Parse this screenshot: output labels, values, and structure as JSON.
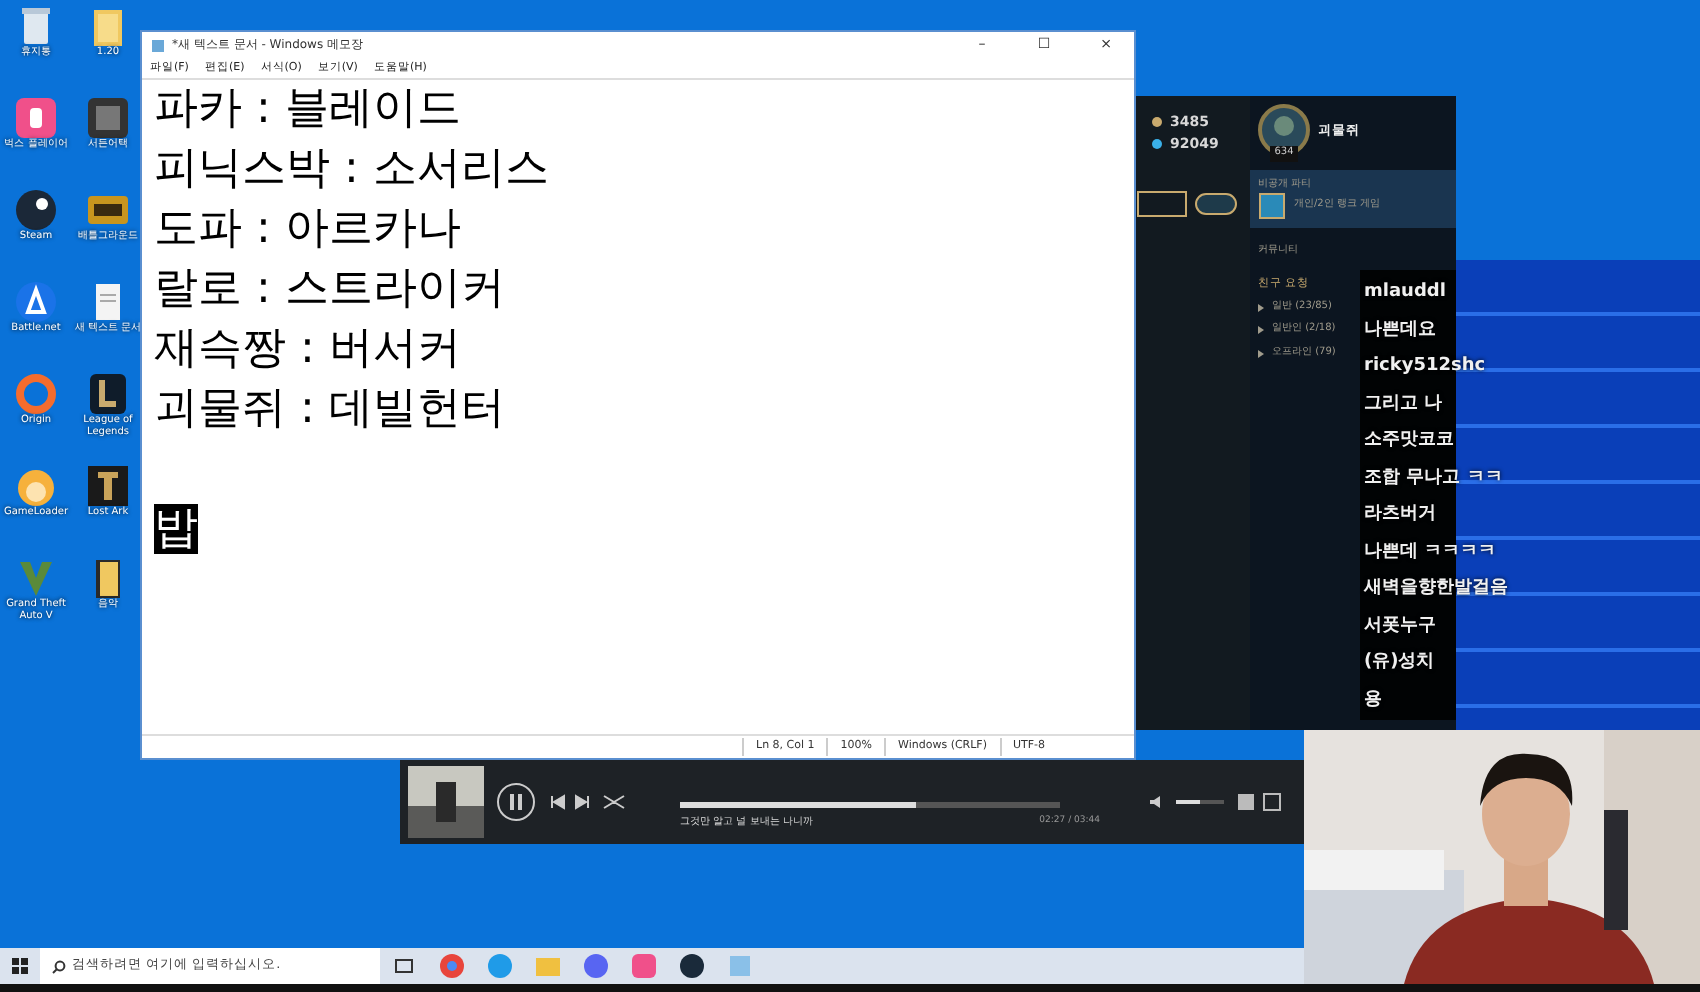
{
  "desktop_icons": [
    {
      "label": "휴지통"
    },
    {
      "label": "1.20"
    },
    {
      "label": "벅스 플레이어"
    },
    {
      "label": "서든어택"
    },
    {
      "label": "Steam"
    },
    {
      "label": "배틀그라운드"
    },
    {
      "label": "Battle.net"
    },
    {
      "label": "새 텍스트 문서"
    },
    {
      "label": "Origin"
    },
    {
      "label": "League of Legends"
    },
    {
      "label": "GameLoader"
    },
    {
      "label": "Lost Ark"
    },
    {
      "label": "Grand Theft Auto V"
    },
    {
      "label": "음악"
    }
  ],
  "notepad": {
    "title": "*새 텍스트 문서 - Windows 메모장",
    "menu": [
      "파일(F)",
      "편집(E)",
      "서식(O)",
      "보기(V)",
      "도움말(H)"
    ],
    "lines": [
      {
        "text": "파카 : 블레이드",
        "selected": false
      },
      {
        "text": "피닉스박 : 소서리스",
        "selected": false
      },
      {
        "text": "도파 : 아르카나",
        "selected": false
      },
      {
        "text": "랄로 : 스트라이커",
        "selected": false
      },
      {
        "text": "재슥짱 : 버서커",
        "selected": false
      },
      {
        "text": "괴물쥐 : 데빌헌터",
        "selected": false
      },
      {
        "text": "밥",
        "selected": true,
        "gap_before": true
      }
    ],
    "window_buttons": [
      "–",
      "☐",
      "×"
    ],
    "status": [
      "Ln 8, Col 1",
      "100%",
      "Windows (CRLF)",
      "UTF-8"
    ]
  },
  "game_client": {
    "currency_1": "3485",
    "currency_2": "92049",
    "level": "634",
    "player_name": "괴물쥐",
    "party": "비공개 파티",
    "queue": "개인/2인 랭크 게임",
    "community": "커뮤니티",
    "friend_requests": "친구 요청",
    "groups": [
      "일반 (23/85)",
      "일반인 (2/18)",
      "오프라인 (79)"
    ]
  },
  "chat": [
    {
      "user": "mlauddl",
      "message": "나쁜데요"
    },
    {
      "user": "ricky512shc",
      "message": "그리고 나"
    },
    {
      "user": "소주맛코코",
      "message": "조합 무나고 ㅋㅋ"
    },
    {
      "user": "라츠버거",
      "message": "나쁜데 ㅋㅋㅋㅋ"
    },
    {
      "user": "새벽을향한발걸음",
      "message": "서폿누구"
    },
    {
      "user": "(유)성치",
      "message": "용"
    }
  ],
  "music_player": {
    "lyric": "그것만 알고 널 보내는 나니까",
    "time": "02:27 / 03:44",
    "level": 0.62,
    "volume_slider": {
      "level": 0.5
    }
  },
  "taskbar": {
    "search_placeholder": "검색하려면 여기에 입력하십시오."
  }
}
